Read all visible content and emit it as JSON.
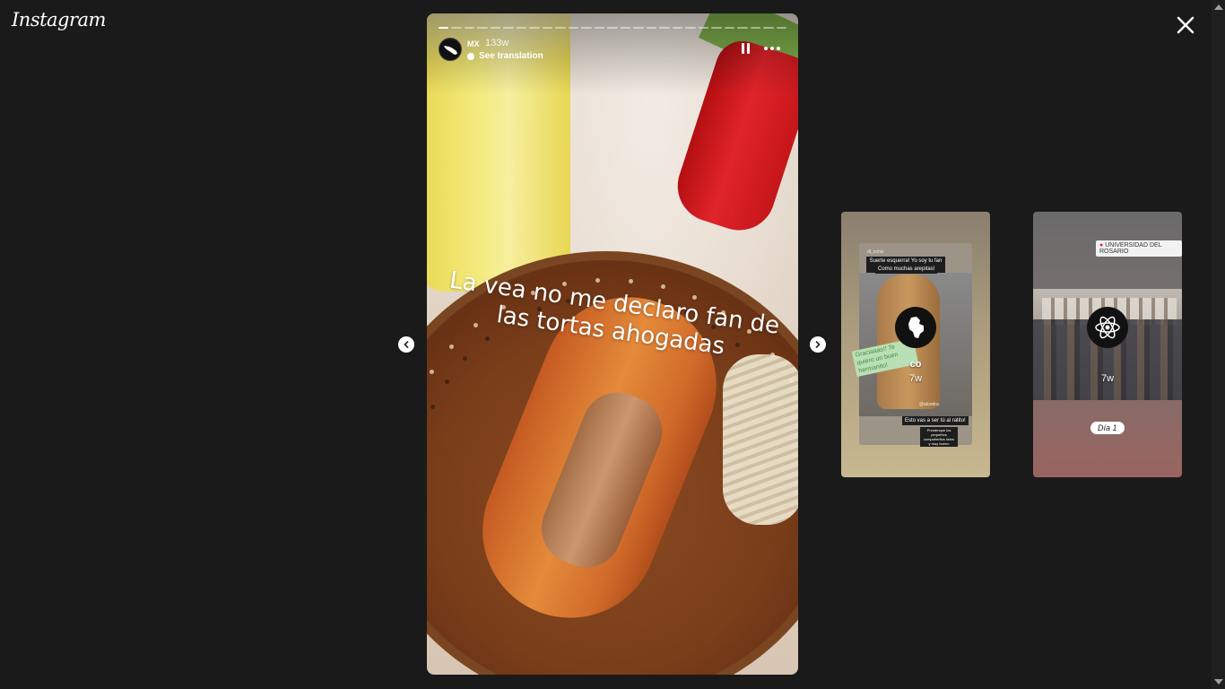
{
  "header": {
    "logo_text": "Instagram"
  },
  "story": {
    "username": "MX",
    "age": "133w",
    "translation_label": "See translation",
    "overlay_text": "La vea no me declaro fan de las tortas ahogadas",
    "progress": {
      "segments": 27,
      "current": 1
    }
  },
  "previews": [
    {
      "name": "co",
      "age": "7w",
      "header_text": "dl_ochiz",
      "text_1": "Suerte esquerra! Yo soy tu fan XD",
      "text_2": "Como muchas arepitas!",
      "green_text": "Graciaaas!! Te quiero un buen hermanito!",
      "mention": "@alondra",
      "caption": "Esto vas a ser tú al ratito!",
      "small_caption": "Prestenque los pequeños compañeritos listos y muy bueno"
    },
    {
      "name": "",
      "age": "7w",
      "location": "UNIVERSIDAD DEL ROSARIO",
      "tag": "Día 1"
    }
  ],
  "colors": {
    "background": "#1a1a1a",
    "text": "#ffffff"
  }
}
